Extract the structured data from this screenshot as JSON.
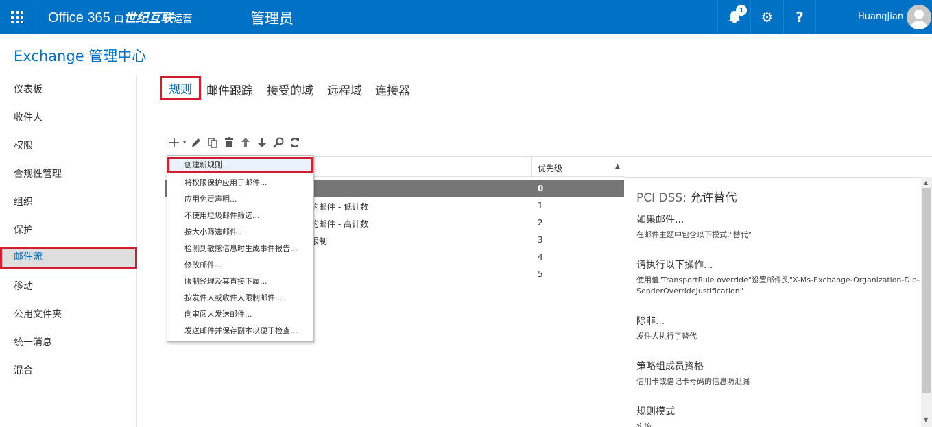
{
  "topbar": {
    "brand_prefix": "Office 365",
    "brand_by": "由",
    "brand_company": "世纪互联",
    "brand_suffix": "运营",
    "admin_title": "管理员",
    "notification_count": "1",
    "help_glyph": "?",
    "gear_glyph": "⚙",
    "username": "HuangJian"
  },
  "page": {
    "title": "Exchange 管理中心"
  },
  "sidebar": {
    "items": [
      {
        "label": "仪表板"
      },
      {
        "label": "收件人"
      },
      {
        "label": "权限"
      },
      {
        "label": "合规性管理"
      },
      {
        "label": "组织"
      },
      {
        "label": "保护"
      },
      {
        "label": "邮件流",
        "active": true
      },
      {
        "label": "移动"
      },
      {
        "label": "公用文件夹"
      },
      {
        "label": "统一消息"
      },
      {
        "label": "混合"
      }
    ]
  },
  "tabs": [
    {
      "label": "规则",
      "active": true
    },
    {
      "label": "邮件跟踪"
    },
    {
      "label": "接受的域"
    },
    {
      "label": "远程域"
    },
    {
      "label": "连接器"
    }
  ],
  "toolbar": {
    "icons": [
      "add-icon",
      "dropdown-caret-icon",
      "edit-icon",
      "copy-icon",
      "delete-icon",
      "move-up-icon",
      "move-down-icon",
      "search-icon",
      "refresh-icon"
    ]
  },
  "grid": {
    "priority_header": "优先级",
    "rows": [
      {
        "name": "",
        "priority": "0",
        "selected": true
      },
      {
        "name": "的邮件 - 低计数",
        "priority": "1"
      },
      {
        "name": "的邮件 - 高计数",
        "priority": "2"
      },
      {
        "name": "限制",
        "priority": "3"
      },
      {
        "name": "",
        "priority": "4"
      },
      {
        "name": "",
        "priority": "5"
      }
    ]
  },
  "dropdown": {
    "items": [
      "创建新规则...",
      "将权限保护应用于邮件...",
      "应用免责声明...",
      "不使用垃圾邮件筛选...",
      "按大小筛选邮件...",
      "检测到敏感信息时生成事件报告...",
      "修改邮件...",
      "限制经理及其直接下属...",
      "按发件人或收件人限制邮件...",
      "向审阅人发送邮件...",
      "发送邮件并保存副本以便于检查..."
    ]
  },
  "detail": {
    "title_prefix": "PCI DSS:",
    "title_rest": "允许替代",
    "if_heading": "如果邮件...",
    "if_text": "在邮件主题中包含以下模式:\"替代\"",
    "do_heading": "请执行以下操作...",
    "do_text": "使用值\"TransportRule override\"设置邮件头\"X-Ms-Exchange-Organization-Dlp-SenderOverrideJustification\"",
    "except_heading": "除非...",
    "except_text": "发件人执行了替代",
    "policy_heading": "策略组成员资格",
    "policy_text": "信用卡或借记卡号码的信息防泄漏",
    "mode_heading": "规则模式",
    "mode_text": "实施"
  },
  "colors": {
    "brand_blue": "#0072c6",
    "highlight_red": "#d0202f",
    "selected_row": "#767676"
  }
}
